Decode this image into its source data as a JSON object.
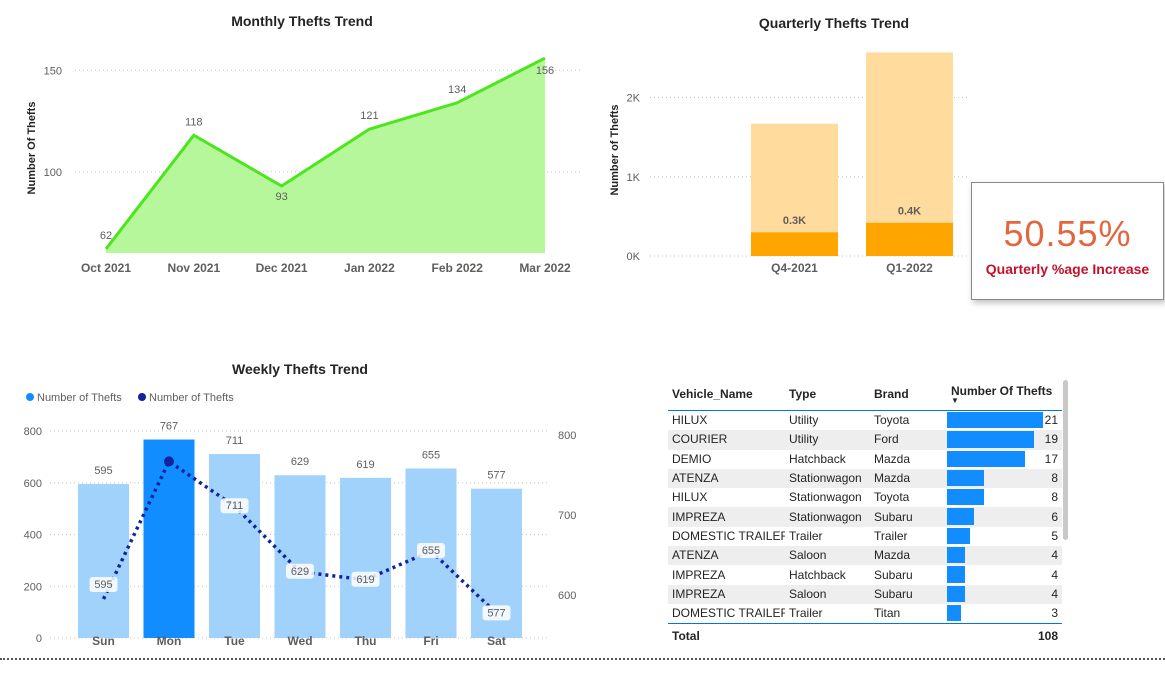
{
  "chart_data": [
    {
      "type": "area",
      "title": "Monthly Thefts Trend",
      "xlabel": "",
      "ylabel": "Number Of Thefts",
      "categories": [
        "Oct 2021",
        "Nov 2021",
        "Dec 2021",
        "Jan 2022",
        "Feb 2022",
        "Mar 2022"
      ],
      "values": [
        62,
        118,
        93,
        121,
        134,
        156
      ],
      "yticks": [
        100,
        150
      ],
      "ylim": [
        60,
        160
      ],
      "color": "#b6f79c",
      "line_color": "#4ce61d",
      "grid": true
    },
    {
      "type": "bar",
      "title": "Quarterly Thefts Trend",
      "ylabel": "Number of Thefts",
      "categories": [
        "Q4-2021",
        "Q1-2022"
      ],
      "yticks": [
        "0K",
        "1K",
        "2K"
      ],
      "ylim": [
        0,
        2600
      ],
      "series": [
        {
          "values": [
            300,
            420
          ],
          "labels": [
            "0.3K",
            "0.4K"
          ],
          "color": "#ffa500"
        },
        {
          "values": [
            1370,
            2150
          ],
          "color": "#ffdc9e"
        }
      ],
      "grid": true
    },
    {
      "type": "bar",
      "title": "Weekly Thefts Trend",
      "categories": [
        "Sun",
        "Mon",
        "Tue",
        "Wed",
        "Thu",
        "Fri",
        "Sat"
      ],
      "legend": [
        "Number of Thefts",
        "Number of Thefts"
      ],
      "legend_colors": [
        "#118dff",
        "#12239e"
      ],
      "series": [
        {
          "type": "bar",
          "values": [
            595,
            767,
            711,
            629,
            619,
            655,
            577
          ],
          "color": "#a1d2fb",
          "highlight_index": 1,
          "highlight_color": "#118dff"
        },
        {
          "type": "line",
          "values": [
            595,
            767,
            711,
            629,
            619,
            655,
            577
          ],
          "color": "#12239e",
          "style": "dotted"
        }
      ],
      "yticks_left": [
        0,
        200,
        400,
        600,
        800
      ],
      "ylim_left": [
        0,
        800
      ],
      "yticks_right": [
        600,
        700,
        800
      ],
      "ylim_right": [
        560,
        820
      ],
      "grid": true
    },
    {
      "type": "table",
      "columns": [
        "Vehicle_Name",
        "Type",
        "Brand",
        "Number Of Thefts"
      ],
      "rows": [
        [
          "HILUX",
          "Utility",
          "Toyota",
          21
        ],
        [
          "COURIER",
          "Utility",
          "Ford",
          19
        ],
        [
          "DEMIO",
          "Hatchback",
          "Mazda",
          17
        ],
        [
          "ATENZA",
          "Stationwagon",
          "Mazda",
          8
        ],
        [
          "HILUX",
          "Stationwagon",
          "Toyota",
          8
        ],
        [
          "IMPREZA",
          "Stationwagon",
          "Subaru",
          6
        ],
        [
          "DOMESTIC TRAILER",
          "Trailer",
          "Trailer",
          5
        ],
        [
          "ATENZA",
          "Saloon",
          "Mazda",
          4
        ],
        [
          "IMPREZA",
          "Hatchback",
          "Subaru",
          4
        ],
        [
          "IMPREZA",
          "Saloon",
          "Subaru",
          4
        ],
        [
          "DOMESTIC TRAILER",
          "Trailer",
          "Titan",
          3
        ]
      ],
      "total_label": "Total",
      "total_value": 108,
      "bar_color": "#118dff"
    }
  ],
  "kpi": {
    "value": "50.55%",
    "label": "Quarterly %age Increase",
    "value_color": "#e3663e",
    "label_color": "#c4112a"
  }
}
